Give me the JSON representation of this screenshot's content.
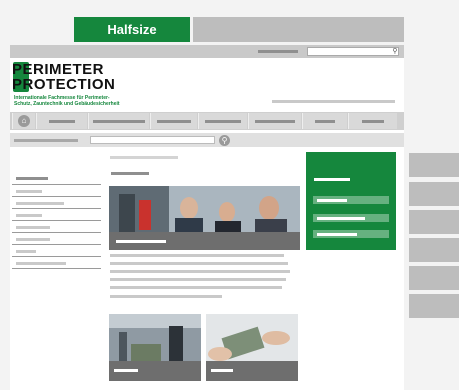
{
  "tabs": {
    "active_label": "Halfsize"
  },
  "header": {
    "logo_line1": "PERIMETER",
    "logo_line2": "PROTECTION",
    "logo_tagline": "Internationale Fachmesse für Perimeter-Schutz, Zauntechnik und Gebäudesicherheit"
  },
  "icons": {
    "home": "home-icon",
    "search": "search-icon"
  },
  "colors": {
    "brand_green": "#15873d",
    "placeholder_gray": "#bdbdbd",
    "caption_gray": "#6e6e6e"
  }
}
